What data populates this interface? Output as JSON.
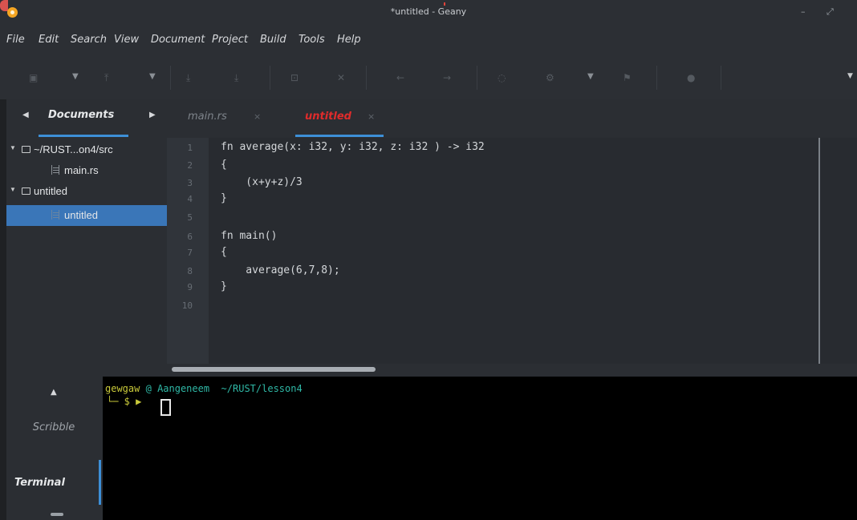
{
  "window": {
    "title": "*untitled - Geany",
    "min_symbol": "–",
    "max_symbol": "⤢"
  },
  "menu": [
    "File",
    "Edit",
    "Search",
    "View",
    "Document",
    "Project",
    "Build",
    "Tools",
    "Help"
  ],
  "toolbar": {
    "icons": [
      "new-icon",
      "dropdown-icon",
      "open-icon",
      "dropdown-icon",
      "save-icon",
      "save-all-icon",
      "revert-icon",
      "close-icon",
      "back-icon",
      "forward-icon",
      "compile-icon",
      "build-icon",
      "dropdown-icon",
      "run-icon",
      "color-picker-icon",
      "overflow-icon"
    ]
  },
  "sidebar": {
    "tab_label": "Documents",
    "tree": [
      {
        "label": "~/RUST...on4/src",
        "type": "folder",
        "expanded": true
      },
      {
        "label": "main.rs",
        "type": "file"
      },
      {
        "label": "untitled",
        "type": "folder",
        "expanded": true
      },
      {
        "label": "untitled",
        "type": "file",
        "selected": true
      }
    ]
  },
  "editor": {
    "tabs": [
      {
        "label": "main.rs",
        "close": "×",
        "active": false
      },
      {
        "label": "untitled",
        "close": "×",
        "active": true,
        "color": "#e02b2b"
      }
    ],
    "line_numbers": [
      "1",
      "2",
      "3",
      "4",
      "5",
      "6",
      "7",
      "8",
      "9",
      "10"
    ],
    "lines": [
      "fn average(x: i32, y: i32, z: i32 ) -> i32",
      "{",
      "    (x+y+z)/3",
      "}",
      "",
      "fn main()",
      "{",
      "    average(6,7,8);",
      "}",
      ""
    ]
  },
  "bottom_panel": {
    "tabs": [
      "Scribble",
      "Terminal"
    ],
    "active_tab": "Terminal",
    "terminal": {
      "user": "gewgaw",
      "at": "@",
      "host": "Aangeneem",
      "path": "~/RUST/lesson4",
      "prompt": "└─ $ ▶"
    }
  },
  "colors": {
    "accent": "#3d8fd7",
    "active_tab_text": "#e02b2b",
    "terminal_user": "#c9c93a",
    "terminal_host": "#2fb8a6",
    "terminal_path": "#2fb8a6"
  }
}
